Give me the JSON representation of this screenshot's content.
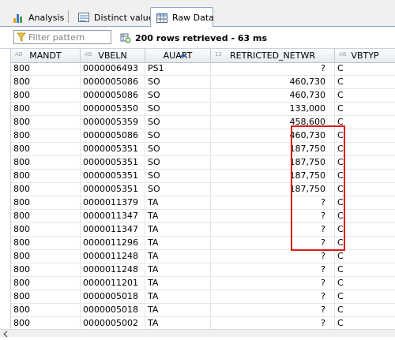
{
  "tabs": [
    {
      "label": "Analysis",
      "icon": "bar-chart-icon",
      "active": false
    },
    {
      "label": "Distinct values",
      "icon": "distinct-values-icon",
      "active": false
    },
    {
      "label": "Raw Data",
      "icon": "table-grid-icon",
      "active": true
    }
  ],
  "toolbar": {
    "filter_placeholder": "Filter pattern",
    "status": "200 rows retrieved - 63 ms"
  },
  "columns": [
    {
      "label": "MANDT",
      "type": "AB"
    },
    {
      "label": "VBELN",
      "type": "AB"
    },
    {
      "label": "AUART",
      "type": "",
      "sorted": "ascending"
    },
    {
      "label": "RETRICTED_NETWR",
      "type": "12"
    },
    {
      "label": "VBTYP",
      "type": "AB"
    }
  ],
  "rows": [
    [
      "800",
      "0000006493",
      "PS1",
      "?",
      "C"
    ],
    [
      "800",
      "0000005086",
      "SO",
      "460,730",
      "C"
    ],
    [
      "800",
      "0000005086",
      "SO",
      "460,730",
      "C"
    ],
    [
      "800",
      "0000005350",
      "SO",
      "133,000",
      "C"
    ],
    [
      "800",
      "0000005359",
      "SO",
      "458,600",
      "C"
    ],
    [
      "800",
      "0000005086",
      "SO",
      "460,730",
      "C"
    ],
    [
      "800",
      "0000005351",
      "SO",
      "187,750",
      "C"
    ],
    [
      "800",
      "0000005351",
      "SO",
      "187,750",
      "C"
    ],
    [
      "800",
      "0000005351",
      "SO",
      "187,750",
      "C"
    ],
    [
      "800",
      "0000005351",
      "SO",
      "187,750",
      "C"
    ],
    [
      "800",
      "0000011379",
      "TA",
      "?",
      "C"
    ],
    [
      "800",
      "0000011347",
      "TA",
      "?",
      "C"
    ],
    [
      "800",
      "0000011347",
      "TA",
      "?",
      "C"
    ],
    [
      "800",
      "0000011296",
      "TA",
      "?",
      "C"
    ],
    [
      "800",
      "0000011248",
      "TA",
      "?",
      "C"
    ],
    [
      "800",
      "0000011248",
      "TA",
      "?",
      "C"
    ],
    [
      "800",
      "0000011201",
      "TA",
      "?",
      "C"
    ],
    [
      "800",
      "0000005018",
      "TA",
      "?",
      "C"
    ],
    [
      "800",
      "0000005018",
      "TA",
      "?",
      "C"
    ],
    [
      "800",
      "0000005002",
      "TA",
      "?",
      "C"
    ]
  ],
  "colors": {
    "highlight": "#dd1a1a",
    "header_border": "#8fa7c8",
    "sort_arrow": "#2a5ea8"
  }
}
